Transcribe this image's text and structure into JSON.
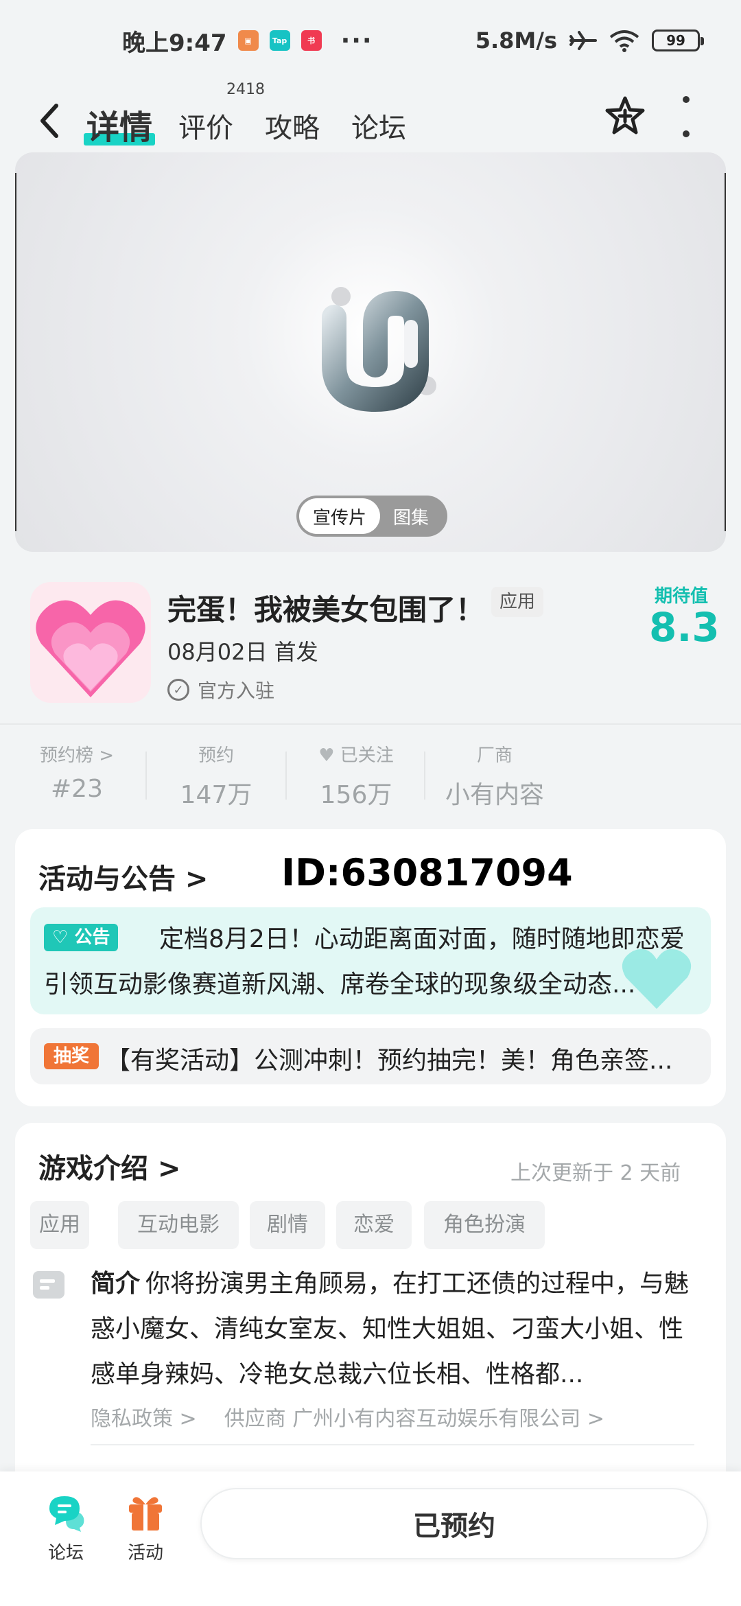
{
  "status_bar": {
    "time": "晚上9:47",
    "apps": [
      "taobao-icon",
      "taptap-icon",
      "xiaohongshu-icon"
    ],
    "speed": "5.8M/s",
    "battery": "99"
  },
  "nav": {
    "tabs": [
      "详情",
      "评价",
      "攻略",
      "论坛"
    ],
    "review_count": "2418"
  },
  "media": {
    "toggle": [
      "宣传片",
      "图集"
    ]
  },
  "app": {
    "title": "完蛋！我被美女包围了！",
    "tag": "应用",
    "release": "08月02日 首发",
    "official": "官方入驻",
    "score_label": "期待值",
    "score": "8.3"
  },
  "stats": [
    {
      "label": "预约榜 >",
      "value": "#23"
    },
    {
      "label": "预约",
      "value": "147万"
    },
    {
      "label": "已关注",
      "value": "156万"
    },
    {
      "label": "厂商",
      "value": "小有内容"
    }
  ],
  "activity": {
    "title": "活动与公告 >",
    "overlay_id": "ID:630817094",
    "notice_badge": "公告",
    "notice_text": "定档8月2日！心动距离面对面，随时随地即恋爱引领互动影像赛道新风潮、席卷全球的现象级全动态...",
    "lottery_badge": "抽奖",
    "lottery_text": "【有奖活动】公测冲刺！预约抽完！美！角色亲签..."
  },
  "intro": {
    "title": "游戏介绍 >",
    "updated": "上次更新于 2 天前",
    "chips": [
      "应用",
      "互动电影",
      "剧情",
      "恋爱",
      "角色扮演"
    ],
    "label": "简介",
    "text": "你将扮演男主角顾易，在打工还债的过程中，与魅惑小魔女、清纯女室友、知性大姐姐、刁蛮大小姐、性感单身辣妈、冷艳女总裁六位长相、性格都...",
    "privacy": "隐私政策 >",
    "supplier": "供应商 广州小有内容互动娱乐有限公司 >"
  },
  "bottom": {
    "forum": "论坛",
    "activity": "活动",
    "reserve": "已预约"
  },
  "colors": {
    "accent": "#19d3c5",
    "score": "#14bfb0",
    "lottery": "#f07537"
  }
}
